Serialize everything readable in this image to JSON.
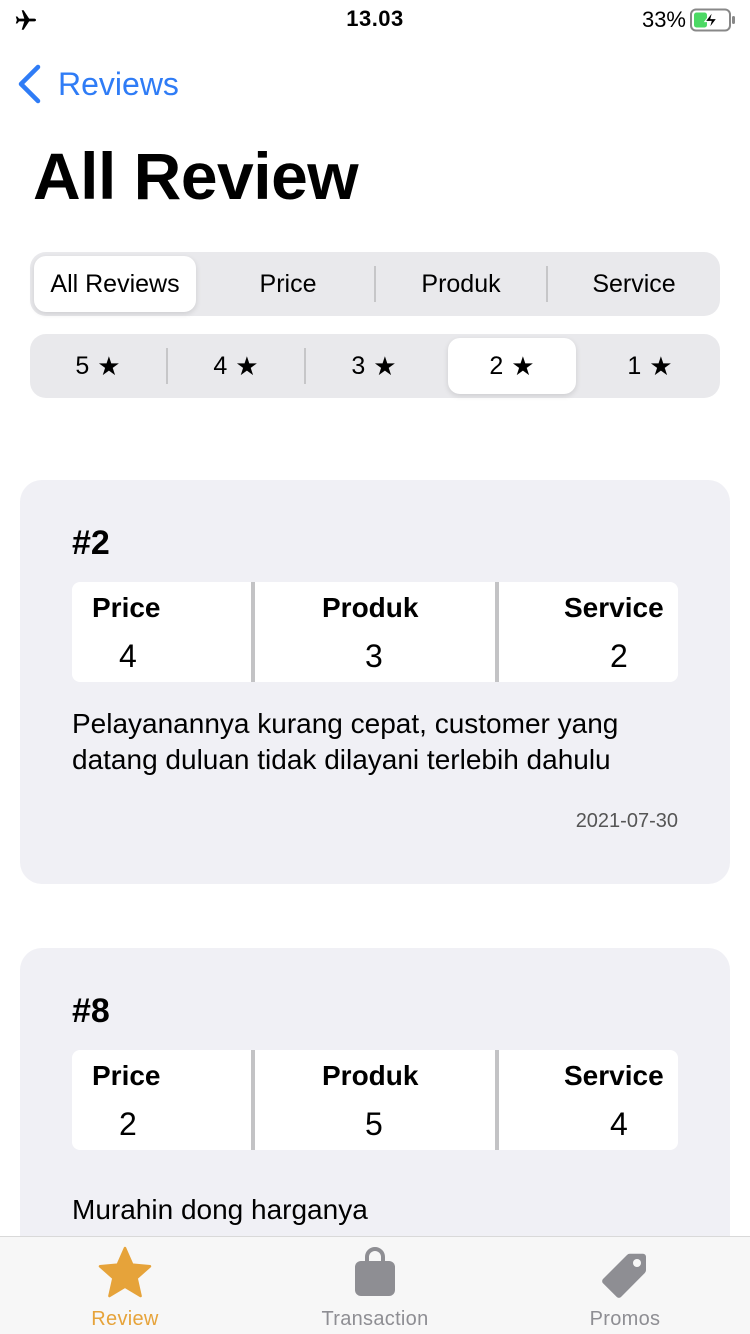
{
  "status_bar": {
    "time": "13.03",
    "battery": "33%"
  },
  "nav": {
    "back_label": "Reviews"
  },
  "page": {
    "title": "All Review"
  },
  "category_tabs": [
    "All Reviews",
    "Price",
    "Produk",
    "Service"
  ],
  "category_selected": "All Reviews",
  "star_tabs": [
    "5",
    "4",
    "3",
    "2",
    "1"
  ],
  "star_glyph": "★",
  "star_selected": "2",
  "reviews": [
    {
      "id": "#2",
      "scores": [
        {
          "label": "Price",
          "value": "4"
        },
        {
          "label": "Produk",
          "value": "3"
        },
        {
          "label": "Service",
          "value": "2"
        }
      ],
      "text": "Pelayanannya kurang cepat, customer yang datang duluan tidak dilayani terlebih dahulu",
      "date": "2021-07-30"
    },
    {
      "id": "#8",
      "scores": [
        {
          "label": "Price",
          "value": "2"
        },
        {
          "label": "Produk",
          "value": "5"
        },
        {
          "label": "Service",
          "value": "4"
        }
      ],
      "text": "Murahin dong harganya"
    }
  ],
  "tab_bar": [
    {
      "label": "Review",
      "icon": "star-icon",
      "active": true
    },
    {
      "label": "Transaction",
      "icon": "bag-icon",
      "active": false
    },
    {
      "label": "Promos",
      "icon": "tag-icon",
      "active": false
    }
  ],
  "colors": {
    "accent": "#2f7cf6",
    "tab_active": "#e6a33a",
    "tab_inactive": "#8e8e93",
    "card_bg": "#f0f0f5"
  }
}
